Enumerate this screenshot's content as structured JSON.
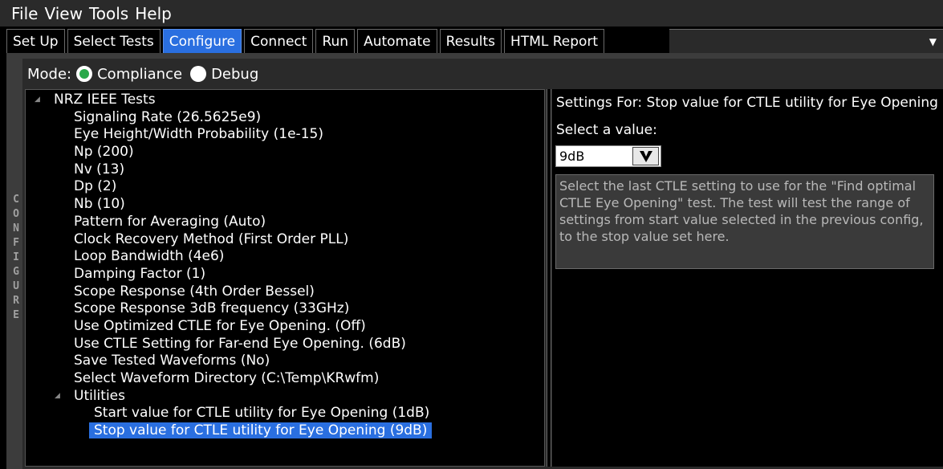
{
  "menu": {
    "items": [
      "File",
      "View",
      "Tools",
      "Help"
    ]
  },
  "tabs": [
    "Set Up",
    "Select Tests",
    "Configure",
    "Connect",
    "Run",
    "Automate",
    "Results",
    "HTML Report"
  ],
  "active_tab": "Configure",
  "side_label": "CONFIGURE",
  "mode": {
    "label": "Mode:",
    "options": [
      "Compliance",
      "Debug"
    ],
    "selected": "Compliance"
  },
  "tree": {
    "root": "NRZ IEEE Tests",
    "items": [
      "Signaling Rate (26.5625e9)",
      "Eye Height/Width Probability (1e-15)",
      "Np (200)",
      "Nv (13)",
      "Dp (2)",
      "Nb (10)",
      "Pattern for Averaging (Auto)",
      "Clock Recovery Method (First Order PLL)",
      "Loop Bandwidth (4e6)",
      "Damping Factor (1)",
      "Scope Response (4th Order Bessel)",
      "Scope Response 3dB frequency (33GHz)",
      "Use Optimized CTLE for Eye Opening. (Off)",
      "Use CTLE Setting for Far-end Eye Opening. (6dB)",
      "Save Tested Waveforms (No)",
      "Select Waveform Directory (C:\\Temp\\KRwfm)"
    ],
    "group": "Utilities",
    "group_items": [
      "Start value for CTLE utility for Eye Opening (1dB)",
      "Stop value for CTLE utility for Eye Opening (9dB)"
    ],
    "selected": "Stop value for CTLE utility for Eye Opening (9dB)"
  },
  "settings": {
    "title": "Settings For: Stop value for CTLE utility for Eye Opening",
    "select_label": "Select a value:",
    "value": "9dB",
    "description": "Select the last CTLE setting to use for the \"Find optimal CTLE Eye Opening\" test.  The test will test the range of settings from start value selected in the previous config, to the stop value set here."
  },
  "colors": {
    "accent": "#2a6fe0",
    "radio_on": "#2aa84a"
  }
}
